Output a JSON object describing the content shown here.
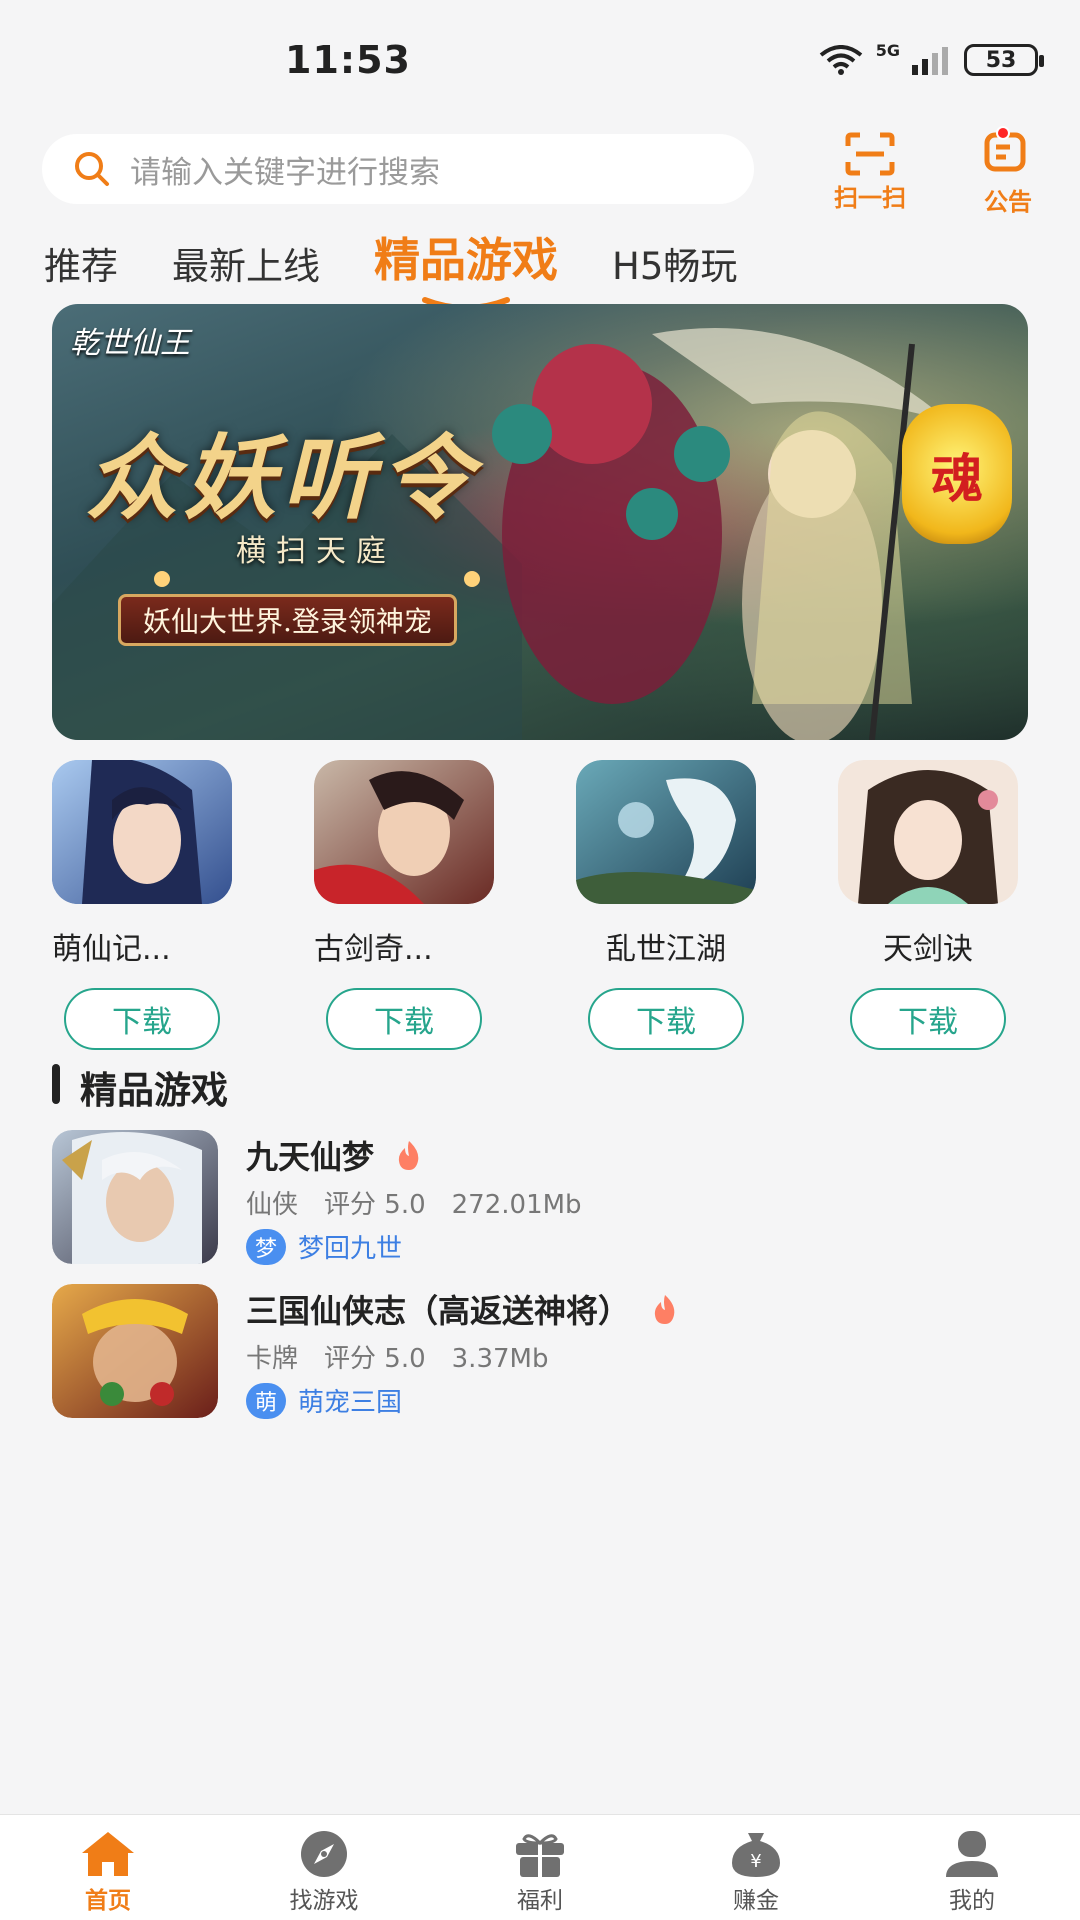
{
  "status_bar": {
    "time": "11:53",
    "battery": "53",
    "network": "5G"
  },
  "search": {
    "placeholder": "请输入关键字进行搜索"
  },
  "top_actions": {
    "scan_label": "扫一扫",
    "notice_label": "公告"
  },
  "tabs": [
    {
      "label": "推荐"
    },
    {
      "label": "最新上线"
    },
    {
      "label": "精品游戏",
      "active": true
    },
    {
      "label": "H5畅玩"
    }
  ],
  "banner": {
    "logo": "乾世仙王",
    "title": "众妖听令",
    "subtitle": "横扫天庭",
    "ribbon": "妖仙大世界.登录领神宠",
    "lantern": "魂"
  },
  "featured": [
    {
      "name": "萌仙记...",
      "button": "下载"
    },
    {
      "name": "古剑奇...",
      "button": "下载"
    },
    {
      "name": "乱世江湖",
      "button": "下载"
    },
    {
      "name": "天剑诀",
      "button": "下载"
    }
  ],
  "section": {
    "title": "精品游戏"
  },
  "games": [
    {
      "title": "九天仙梦",
      "category": "仙侠",
      "rating": "评分 5.0",
      "size": "272.01Mb",
      "tag_badge": "梦",
      "tag": "梦回九世"
    },
    {
      "title": "三国仙侠志（高返送神将）",
      "category": "卡牌",
      "rating": "评分 5.0",
      "size": "3.37Mb",
      "tag_badge": "萌",
      "tag": "萌宠三国"
    }
  ],
  "bottom_nav": [
    {
      "label": "首页",
      "active": true
    },
    {
      "label": "找游戏"
    },
    {
      "label": "福利"
    },
    {
      "label": "赚金"
    },
    {
      "label": "我的"
    }
  ],
  "colors": {
    "accent": "#f07d17",
    "download": "#26a58c",
    "tag": "#4a8ff0",
    "badge_dot": "#ff2626"
  }
}
